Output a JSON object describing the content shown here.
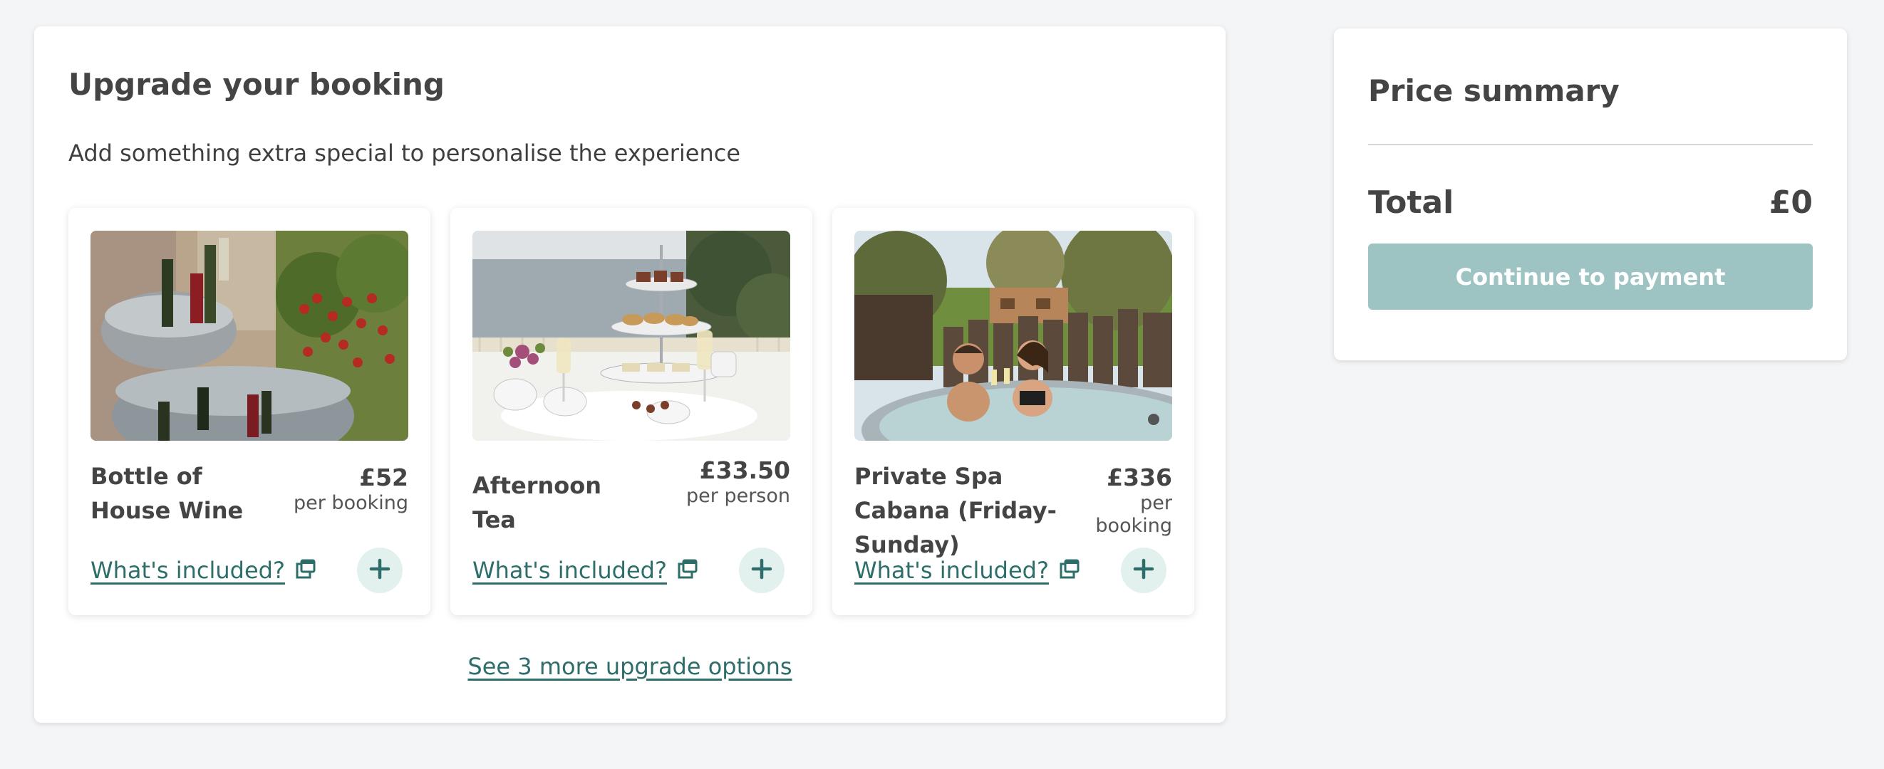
{
  "upgrade": {
    "title": "Upgrade your booking",
    "subtitle": "Add something extra special to personalise the experience",
    "items": [
      {
        "name": "Bottle of House Wine",
        "price": "£52",
        "unit": "per booking",
        "link": "What's included?",
        "image": "wine-bottles-image"
      },
      {
        "name": "Afternoon Tea",
        "price": "£33.50",
        "unit": "per person",
        "link": "What's included?",
        "image": "afternoon-tea-image"
      },
      {
        "name": "Private Spa Cabana (Friday-Sunday)",
        "price": "£336",
        "unit": "per booking",
        "link": "What's included?",
        "image": "spa-hot-tub-image"
      }
    ],
    "more_link": "See 3 more upgrade options"
  },
  "summary": {
    "title": "Price summary",
    "total_label": "Total",
    "total_value": "£0",
    "continue_label": "Continue to payment"
  },
  "colors": {
    "accent": "#2e6e6a",
    "button_disabled": "#9dc4c2",
    "add_button_bg": "#e2f0ee",
    "page_bg": "#f4f5f7"
  }
}
